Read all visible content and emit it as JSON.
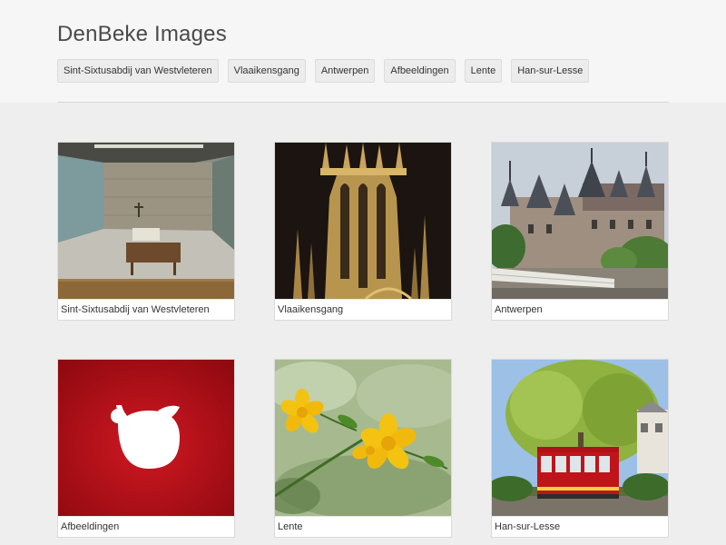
{
  "site": {
    "title": "DenBeke Images"
  },
  "tags": [
    "Sint-Sixtusabdij van Westvleteren",
    "Vlaaikensgang",
    "Antwerpen",
    "Afbeeldingen",
    "Lente",
    "Han-sur-Lesse"
  ],
  "albums": [
    {
      "caption": "Sint-Sixtusabdij van Westvleteren",
      "image": "abbey-interior-photo"
    },
    {
      "caption": "Vlaaikensgang",
      "image": "cathedral-spire-photo"
    },
    {
      "caption": "Antwerpen",
      "image": "castle-photo"
    },
    {
      "caption": "Afbeeldingen",
      "image": "freebsd-daemon-logo"
    },
    {
      "caption": "Lente",
      "image": "yellow-flowers-photo"
    },
    {
      "caption": "Han-sur-Lesse",
      "image": "red-tram-photo"
    }
  ],
  "colors": {
    "background": "#eeeeee",
    "header": "#f6f6f6",
    "logo_red": "#c5121b"
  }
}
